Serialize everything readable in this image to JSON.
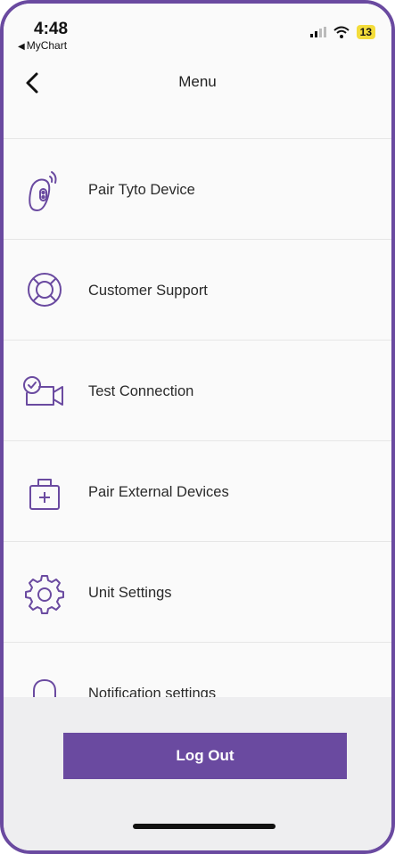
{
  "status_bar": {
    "time": "4:48",
    "back_app": "MyChart",
    "battery": "13"
  },
  "nav": {
    "title": "Menu"
  },
  "menu": {
    "items": [
      {
        "label": "Pair Tyto Device",
        "icon": "tyto-device-icon"
      },
      {
        "label": "Customer Support",
        "icon": "lifebuoy-icon"
      },
      {
        "label": "Test Connection",
        "icon": "video-camera-check-icon"
      },
      {
        "label": "Pair External Devices",
        "icon": "medical-kit-icon"
      },
      {
        "label": "Unit Settings",
        "icon": "gear-icon"
      },
      {
        "label": "Notification settings",
        "icon": "bell-icon"
      }
    ]
  },
  "footer": {
    "logout_label": "Log Out"
  },
  "colors": {
    "accent": "#6a4aa0",
    "battery": "#f3dc3b"
  }
}
